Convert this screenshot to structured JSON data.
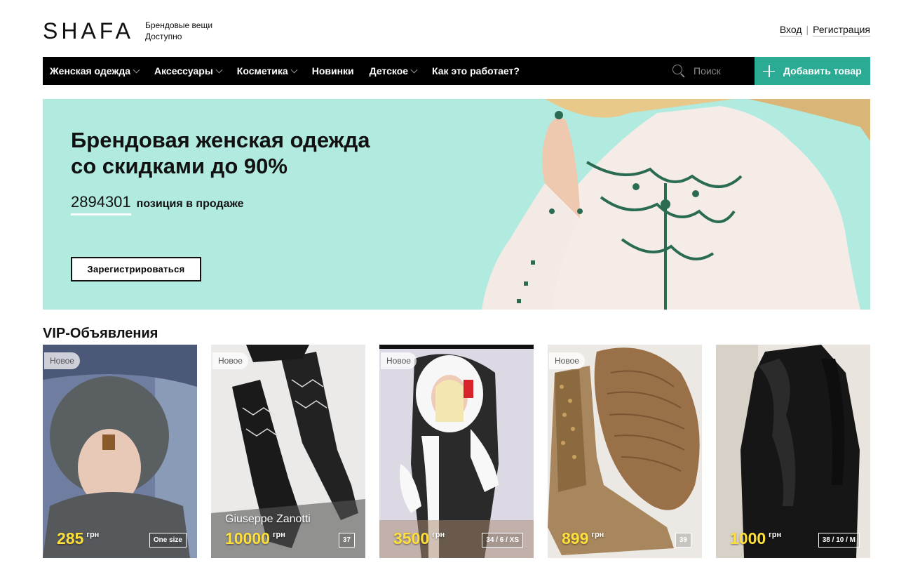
{
  "header": {
    "logo": "SHAFA",
    "tagline_line1": "Брендовые вещи",
    "tagline_line2": "Доступно",
    "login": "Вход",
    "separator": "|",
    "register": "Регистрация"
  },
  "nav": {
    "items": [
      {
        "label": "Женская одежда",
        "dropdown": true
      },
      {
        "label": "Аксессуары",
        "dropdown": true
      },
      {
        "label": "Косметика",
        "dropdown": true
      },
      {
        "label": "Новинки",
        "dropdown": false
      },
      {
        "label": "Детское",
        "dropdown": true
      },
      {
        "label": "Как это работает?",
        "dropdown": false
      }
    ],
    "search_placeholder": "Поиск",
    "add_button": "Добавить товар",
    "accent_color": "#2bab94"
  },
  "hero": {
    "title_line1": "Брендовая женская одежда",
    "title_line2": "со скидками до 90%",
    "count": "2894301",
    "count_label": "позиция в продаже",
    "register_button": "Зарегистрироваться",
    "background_color": "#b1ebe0"
  },
  "vip": {
    "title": "VIP-Объявления",
    "cards": [
      {
        "badge": "Новое",
        "price": "285",
        "currency": "грн",
        "size": "One size",
        "brand": ""
      },
      {
        "badge": "Новое",
        "price": "10000",
        "currency": "грн",
        "size": "37",
        "brand": "Giuseppe Zanotti"
      },
      {
        "badge": "Новое",
        "price": "3500",
        "currency": "грн",
        "size": "34 / 6 / XS",
        "brand": ""
      },
      {
        "badge": "Новое",
        "price": "899",
        "currency": "грн",
        "size": "39",
        "brand": ""
      },
      {
        "badge": "",
        "price": "1000",
        "currency": "грн",
        "size": "38 / 10 / M",
        "brand": ""
      }
    ]
  }
}
